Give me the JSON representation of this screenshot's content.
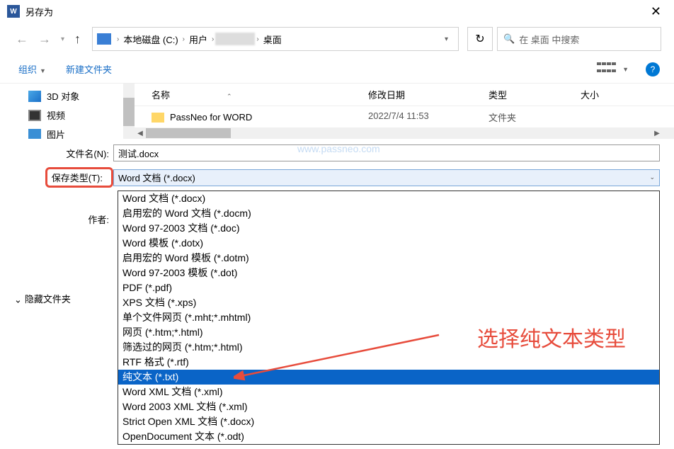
{
  "window": {
    "title": "另存为"
  },
  "breadcrumbs": {
    "drive": "本地磁盘 (C:)",
    "users": "用户",
    "desktop": "桌面"
  },
  "search": {
    "placeholder": "在 桌面 中搜索"
  },
  "toolbar": {
    "organize": "组织",
    "new_folder": "新建文件夹"
  },
  "sidebar": {
    "items": [
      {
        "label": "3D 对象"
      },
      {
        "label": "视频"
      },
      {
        "label": "图片"
      }
    ]
  },
  "columns": {
    "name": "名称",
    "date": "修改日期",
    "type": "类型",
    "size": "大小"
  },
  "files": [
    {
      "name": "PassNeo for WORD",
      "date": "2022/7/4 11:53",
      "type": "文件夹"
    }
  ],
  "form": {
    "filename_label": "文件名(N):",
    "filename_value": "测试.docx",
    "filetype_label": "保存类型(T):",
    "filetype_value": "Word 文档 (*.docx)",
    "author_label": "作者:"
  },
  "hide_folders": "隐藏文件夹",
  "watermark": "www.passneo.com",
  "annotation": "选择纯文本类型",
  "filetype_options": [
    "Word 文档 (*.docx)",
    "启用宏的 Word 文档 (*.docm)",
    "Word 97-2003 文档 (*.doc)",
    "Word 模板 (*.dotx)",
    "启用宏的 Word 模板 (*.dotm)",
    "Word 97-2003 模板 (*.dot)",
    "PDF (*.pdf)",
    "XPS 文档 (*.xps)",
    "单个文件网页 (*.mht;*.mhtml)",
    "网页 (*.htm;*.html)",
    "筛选过的网页 (*.htm;*.html)",
    "RTF 格式 (*.rtf)",
    "纯文本 (*.txt)",
    "Word XML 文档 (*.xml)",
    "Word 2003 XML 文档 (*.xml)",
    "Strict Open XML 文档 (*.docx)",
    "OpenDocument 文本 (*.odt)"
  ],
  "selected_option_index": 12
}
